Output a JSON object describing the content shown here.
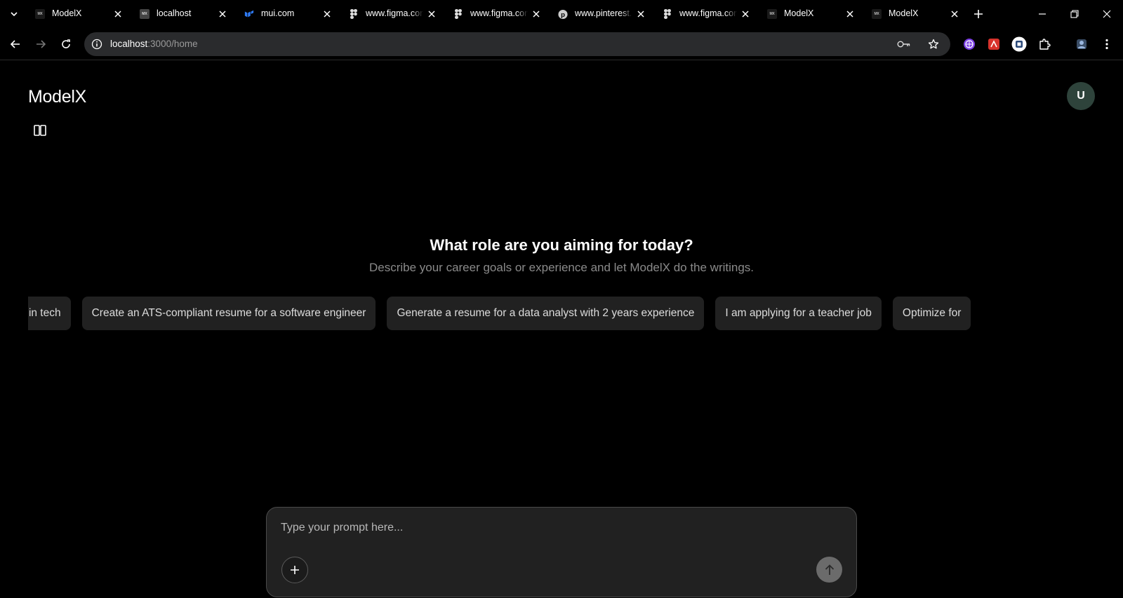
{
  "browser": {
    "tabs": [
      {
        "title": "ModelX",
        "favicon": "modelx-favicon",
        "favicon_text": "MX"
      },
      {
        "title": "localhost",
        "favicon": "localhost-favicon",
        "favicon_text": "MX"
      },
      {
        "title": "mui.com",
        "favicon": "mui-icon"
      },
      {
        "title": "www.figma.com",
        "favicon": "figma-icon"
      },
      {
        "title": "www.figma.com",
        "favicon": "figma-icon"
      },
      {
        "title": "www.pinterest.com",
        "favicon": "pinterest-icon"
      },
      {
        "title": "www.figma.com",
        "favicon": "figma-icon"
      },
      {
        "title": "ModelX",
        "favicon": "modelx-favicon",
        "favicon_text": "MX"
      },
      {
        "title": "ModelX",
        "favicon": "modelx-favicon",
        "favicon_text": "MX"
      }
    ],
    "address": {
      "host": "localhost",
      "path": ":3000/home"
    },
    "extensions": [
      "purple-globe-extension-icon",
      "red-extension-icon",
      "profile-extension-icon",
      "puzzle-extensions-icon",
      "profile-icon",
      "menu-icon"
    ]
  },
  "app": {
    "logo": "ModelX",
    "avatar_initial": "U",
    "hero": {
      "title": "What role are you aiming for today?",
      "subtitle": "Describe your career goals or experience and let ModelX do the writings."
    },
    "suggestions": [
      "Write a resume for a marketing role in tech",
      "Create an ATS-compliant resume for a software engineer",
      "Generate a resume for a data analyst with 2 years experience",
      "I am applying for a teacher job",
      "Optimize for"
    ],
    "composer": {
      "placeholder": "Type your prompt here..."
    }
  },
  "colors": {
    "background": "#000000",
    "chip_bg": "#212121",
    "composer_bg": "#212121",
    "avatar_bg": "#2e433b",
    "send_button": "#6b6b6b",
    "subtitle": "#8a8a8a"
  }
}
